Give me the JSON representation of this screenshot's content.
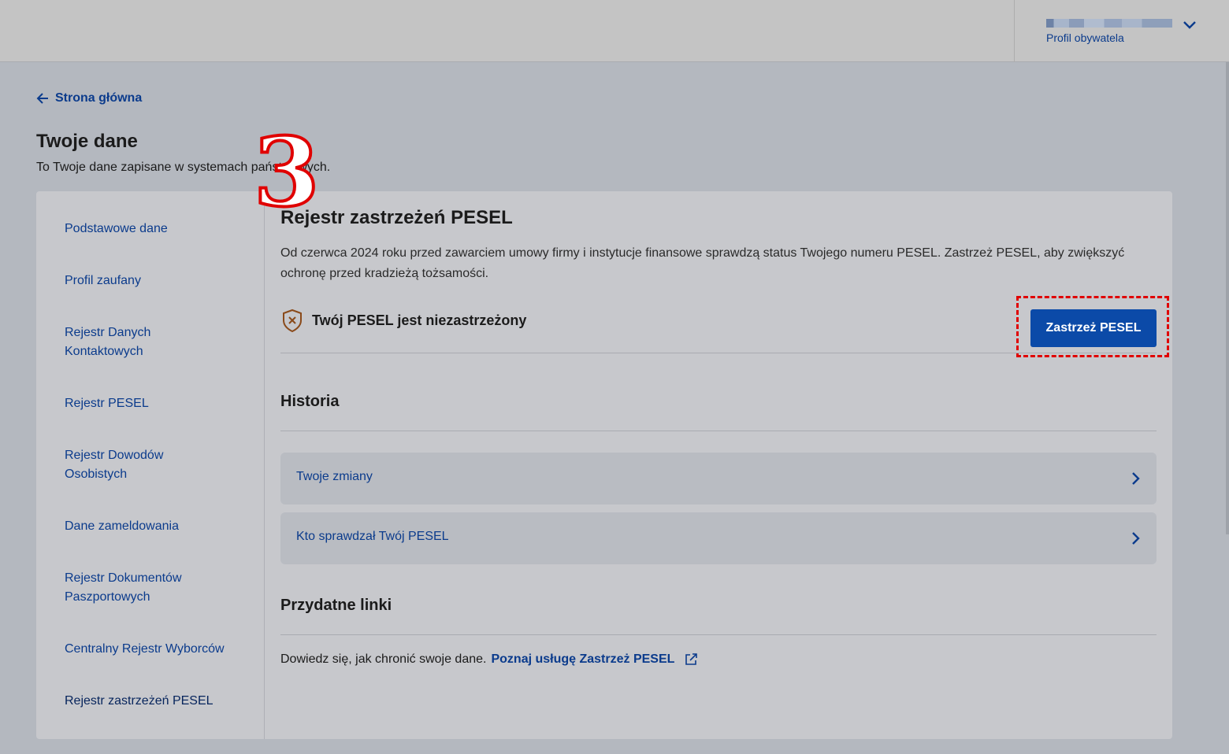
{
  "header": {
    "profile_label": "Profil obywatela"
  },
  "nav": {
    "back_label": "Strona główna"
  },
  "page": {
    "title": "Twoje dane",
    "subtitle": "To Twoje dane zapisane w systemach państwowych."
  },
  "sidebar": {
    "items": [
      {
        "label": "Podstawowe dane"
      },
      {
        "label": "Profil zaufany"
      },
      {
        "label": "Rejestr Danych Kontaktowych"
      },
      {
        "label": "Rejestr PESEL"
      },
      {
        "label": "Rejestr Dowodów Osobistych"
      },
      {
        "label": "Dane zameldowania"
      },
      {
        "label": "Rejestr Dokumentów Paszportowych"
      },
      {
        "label": "Centralny Rejestr Wyborców"
      },
      {
        "label": "Rejestr zastrzeżeń PESEL"
      }
    ],
    "active_index": 8
  },
  "main": {
    "title": "Rejestr zastrzeżeń PESEL",
    "intro": "Od czerwca 2024 roku przed zawarciem umowy firmy i instytucje finansowe sprawdzą status Twojego numeru PESEL. Zastrzeż PESEL, aby zwiększyć ochronę przed kradzieżą tożsamości.",
    "status_text": "Twój PESEL jest niezastrzeżony",
    "status_icon": "shield-x-icon",
    "action_label": "Zastrzeż PESEL",
    "history": {
      "title": "Historia",
      "rows": [
        {
          "label": "Twoje zmiany"
        },
        {
          "label": "Kto sprawdzał Twój PESEL"
        }
      ]
    },
    "links": {
      "title": "Przydatne linki",
      "text": "Dowiedz się, jak chronić swoje dane.",
      "link_label": "Poznaj usługę Zastrzeż PESEL"
    }
  },
  "overlay": {
    "step_number": "3"
  },
  "colors": {
    "accent": "#0b4aa8",
    "link": "#0b3b8c",
    "highlight": "#e00000"
  }
}
